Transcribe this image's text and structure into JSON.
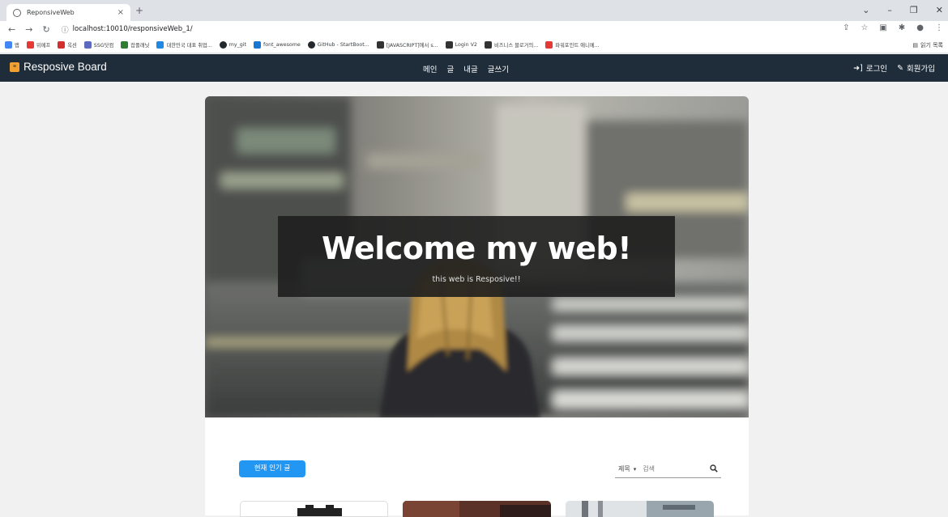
{
  "browser": {
    "tab_title": "ReponsiveWeb",
    "tab_close": "×",
    "new_tab": "+",
    "url": "localhost:10010/responsiveWeb_1/",
    "reading_list": "읽기 목록"
  },
  "bookmarks": [
    {
      "label": "앱",
      "color": "#4285f4"
    },
    {
      "label": "위메프",
      "color": "#e53935"
    },
    {
      "label": "옥션",
      "color": "#d32f2f"
    },
    {
      "label": "SSG닷컴",
      "color": "#5c6bc0"
    },
    {
      "label": "잡플래닛",
      "color": "#2e7d32"
    },
    {
      "label": "대한민국 대표 취업...",
      "color": "#1e88e5"
    },
    {
      "label": "my_git",
      "color": "#24292e"
    },
    {
      "label": "font_awesome",
      "color": "#1976d2"
    },
    {
      "label": "GitHub - StartBoot...",
      "color": "#24292e"
    },
    {
      "label": "[JAVASCRIPT]에서 s...",
      "color": "#333333"
    },
    {
      "label": "Login V2",
      "color": "#333333"
    },
    {
      "label": "비즈니스 블로거의...",
      "color": "#333333"
    },
    {
      "label": "파워포인트 애니메...",
      "color": "#e53935"
    }
  ],
  "site": {
    "brand": "Resposive Board",
    "menu": [
      "메인",
      "글",
      "내글",
      "글쓰기"
    ],
    "login": "로그인",
    "signup": "회원가입"
  },
  "hero": {
    "title": "Welcome my web!",
    "subtitle": "this web is Resposive!!"
  },
  "content": {
    "popular_button": "현재 인기 글",
    "search_select": "제목",
    "search_placeholder": "검색"
  },
  "colors": {
    "navbar": "#1f2d3a",
    "accent": "#2196f3",
    "brand_logo": "#f0a030"
  }
}
